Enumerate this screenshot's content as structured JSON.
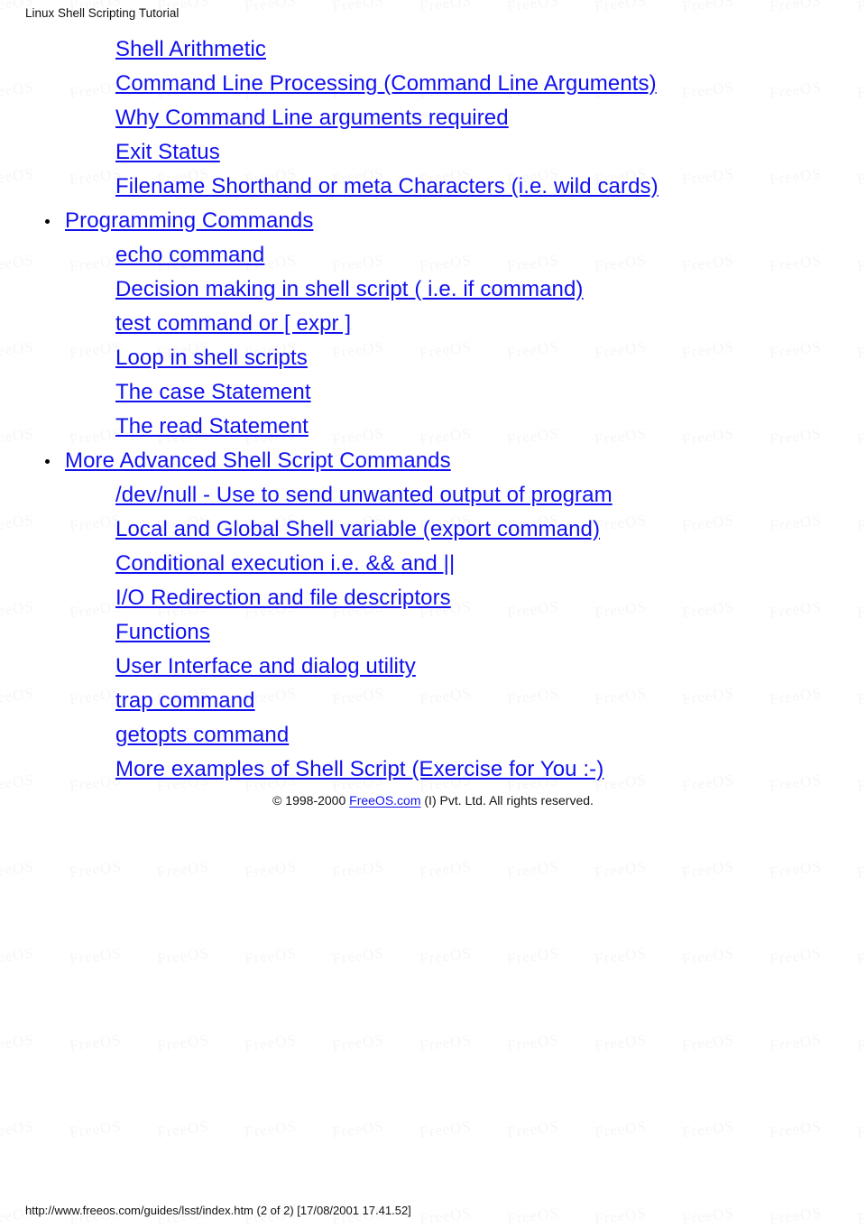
{
  "page": {
    "header_title": "Linux Shell Scripting Tutorial",
    "footer_line": "http://www.freeos.com/guides/lsst/index.htm (2 of 2) [17/08/2001 17.41.52]",
    "link_color": "#1111ee",
    "text_color": "#111111",
    "background_color": "#ffffff",
    "watermark_text": "FreeOS"
  },
  "toc": {
    "items": [
      {
        "level": 2,
        "bullet": false,
        "label": "Shell Arithmetic"
      },
      {
        "level": 2,
        "bullet": false,
        "label": "Command Line Processing (Command Line Arguments)"
      },
      {
        "level": 2,
        "bullet": false,
        "label": "Why Command Line arguments required"
      },
      {
        "level": 2,
        "bullet": false,
        "label": "Exit Status"
      },
      {
        "level": 2,
        "bullet": false,
        "label": "Filename Shorthand or meta Characters (i.e. wild cards)"
      },
      {
        "level": 1,
        "bullet": true,
        "label": "Programming Commands"
      },
      {
        "level": 2,
        "bullet": false,
        "label": "echo command"
      },
      {
        "level": 2,
        "bullet": false,
        "label": "Decision making in shell script ( i.e. if command)"
      },
      {
        "level": 2,
        "bullet": false,
        "label": "test command or [ expr ]"
      },
      {
        "level": 2,
        "bullet": false,
        "label": "Loop in shell scripts"
      },
      {
        "level": 2,
        "bullet": false,
        "label": "The case Statement"
      },
      {
        "level": 2,
        "bullet": false,
        "label": "The read Statement"
      },
      {
        "level": 1,
        "bullet": true,
        "label": "More Advanced Shell Script Commands"
      },
      {
        "level": 2,
        "bullet": false,
        "label": "/dev/null - Use to send unwanted output of program"
      },
      {
        "level": 2,
        "bullet": false,
        "label": "Local and Global Shell variable (export command)"
      },
      {
        "level": 2,
        "bullet": false,
        "label": "Conditional execution i.e. && and ||"
      },
      {
        "level": 2,
        "bullet": false,
        "label": "I/O Redirection and file descriptors"
      },
      {
        "level": 2,
        "bullet": false,
        "label": "Functions"
      },
      {
        "level": 2,
        "bullet": false,
        "label": "User Interface and dialog utility"
      },
      {
        "level": 2,
        "bullet": false,
        "label": "trap command"
      },
      {
        "level": 2,
        "bullet": false,
        "label": "getopts command"
      },
      {
        "level": 2,
        "bullet": false,
        "label": "More examples of Shell Script (Exercise for You :-)"
      }
    ]
  },
  "copyright": {
    "prefix": "© 1998-2000 ",
    "link_label": "FreeOS.com",
    "suffix": " (I) Pvt. Ltd. All rights reserved."
  }
}
